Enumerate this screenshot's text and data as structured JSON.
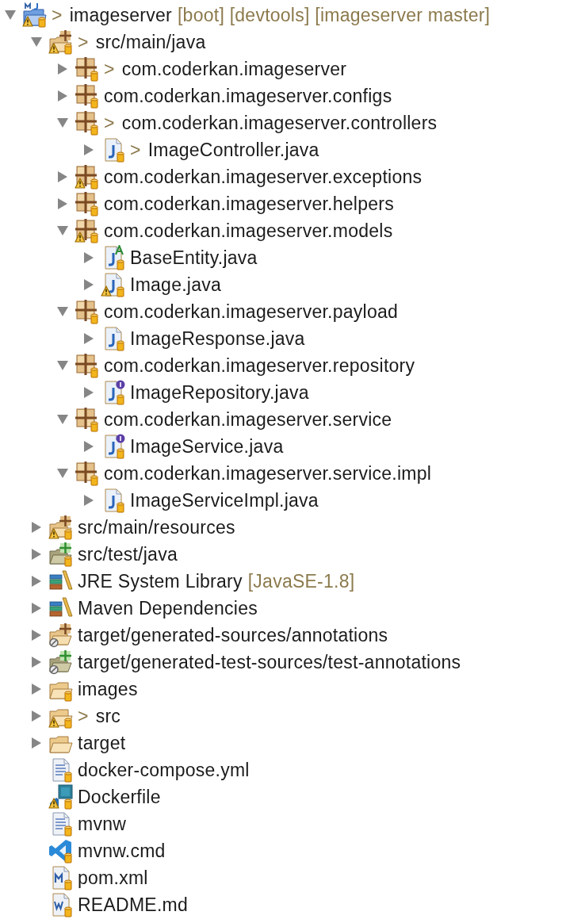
{
  "tree": [
    {
      "kind": "project",
      "prefix": ">",
      "label": "imageserver",
      "decorations": "[boot] [devtools] [imageserver master]",
      "expanded": true,
      "warning": true,
      "shared": true,
      "children": [
        {
          "kind": "source-folder",
          "prefix": ">",
          "label": "src/main/java",
          "expanded": true,
          "warning": true,
          "shared": true,
          "excluded": false,
          "children": [
            {
              "kind": "package",
              "prefix": ">",
              "label": "com.coderkan.imageserver",
              "expanded": false,
              "warning": false,
              "shared": true
            },
            {
              "kind": "package",
              "label": "com.coderkan.imageserver.configs",
              "expanded": false,
              "warning": false,
              "shared": true
            },
            {
              "kind": "package",
              "prefix": ">",
              "label": "com.coderkan.imageserver.controllers",
              "expanded": true,
              "warning": false,
              "shared": true,
              "children": [
                {
                  "kind": "java-class",
                  "prefix": ">",
                  "label": "ImageController.java",
                  "expanded": false,
                  "warning": false,
                  "shared": true
                }
              ]
            },
            {
              "kind": "package",
              "label": "com.coderkan.imageserver.exceptions",
              "expanded": false,
              "warning": true,
              "shared": true
            },
            {
              "kind": "package",
              "label": "com.coderkan.imageserver.helpers",
              "expanded": false,
              "warning": false,
              "shared": true
            },
            {
              "kind": "package",
              "label": "com.coderkan.imageserver.models",
              "expanded": true,
              "warning": true,
              "shared": true,
              "children": [
                {
                  "kind": "java-abstract",
                  "label": "BaseEntity.java",
                  "expanded": false,
                  "warning": false,
                  "shared": true
                },
                {
                  "kind": "java-class",
                  "label": "Image.java",
                  "expanded": false,
                  "warning": true,
                  "shared": true
                }
              ]
            },
            {
              "kind": "package",
              "label": "com.coderkan.imageserver.payload",
              "expanded": true,
              "warning": false,
              "shared": true,
              "children": [
                {
                  "kind": "java-class",
                  "label": "ImageResponse.java",
                  "expanded": false,
                  "warning": false,
                  "shared": true
                }
              ]
            },
            {
              "kind": "package",
              "label": "com.coderkan.imageserver.repository",
              "expanded": true,
              "warning": false,
              "shared": true,
              "children": [
                {
                  "kind": "java-interface",
                  "label": "ImageRepository.java",
                  "expanded": false,
                  "warning": false,
                  "shared": true
                }
              ]
            },
            {
              "kind": "package",
              "label": "com.coderkan.imageserver.service",
              "expanded": true,
              "warning": false,
              "shared": true,
              "children": [
                {
                  "kind": "java-interface",
                  "label": "ImageService.java",
                  "expanded": false,
                  "warning": false,
                  "shared": true
                }
              ]
            },
            {
              "kind": "package",
              "label": "com.coderkan.imageserver.service.impl",
              "expanded": true,
              "warning": false,
              "shared": true,
              "children": [
                {
                  "kind": "java-class",
                  "label": "ImageServiceImpl.java",
                  "expanded": false,
                  "warning": false,
                  "shared": true
                }
              ]
            }
          ]
        },
        {
          "kind": "source-folder",
          "label": "src/main/resources",
          "expanded": false,
          "warning": true,
          "shared": true,
          "excluded": false
        },
        {
          "kind": "test-source-folder",
          "label": "src/test/java",
          "expanded": false,
          "warning": false,
          "shared": true,
          "excluded": false
        },
        {
          "kind": "library",
          "label": "JRE System Library",
          "decorations": "[JavaSE-1.8]",
          "expanded": false,
          "warning": false,
          "shared": false,
          "excluded": false
        },
        {
          "kind": "library",
          "label": "Maven Dependencies",
          "expanded": false,
          "warning": false,
          "shared": false,
          "excluded": false
        },
        {
          "kind": "source-folder",
          "label": "target/generated-sources/annotations",
          "expanded": false,
          "warning": false,
          "shared": false,
          "excluded": true
        },
        {
          "kind": "test-source-folder",
          "label": "target/generated-test-sources/test-annotations",
          "expanded": false,
          "warning": false,
          "shared": false,
          "excluded": true
        },
        {
          "kind": "folder",
          "label": "images",
          "expanded": false,
          "warning": false,
          "shared": true,
          "excluded": false
        },
        {
          "kind": "folder",
          "prefix": ">",
          "label": "src",
          "expanded": false,
          "warning": true,
          "shared": true,
          "excluded": false
        },
        {
          "kind": "folder",
          "label": "target",
          "expanded": false,
          "warning": false,
          "shared": false,
          "excluded": false
        },
        {
          "kind": "text-file",
          "label": "docker-compose.yml",
          "warning": false,
          "shared": true,
          "excluded": false
        },
        {
          "kind": "docker-file",
          "label": "Dockerfile",
          "warning": true,
          "shared": true,
          "excluded": false
        },
        {
          "kind": "text-file",
          "label": "mvnw",
          "warning": false,
          "shared": true,
          "excluded": false
        },
        {
          "kind": "cmd-file",
          "label": "mvnw.cmd",
          "warning": false,
          "shared": true,
          "excluded": false
        },
        {
          "kind": "xml-file",
          "label": "pom.xml",
          "warning": false,
          "shared": true,
          "excluded": false
        },
        {
          "kind": "markdown-file",
          "label": "README.md",
          "warning": false,
          "shared": true,
          "excluded": false
        }
      ]
    }
  ]
}
